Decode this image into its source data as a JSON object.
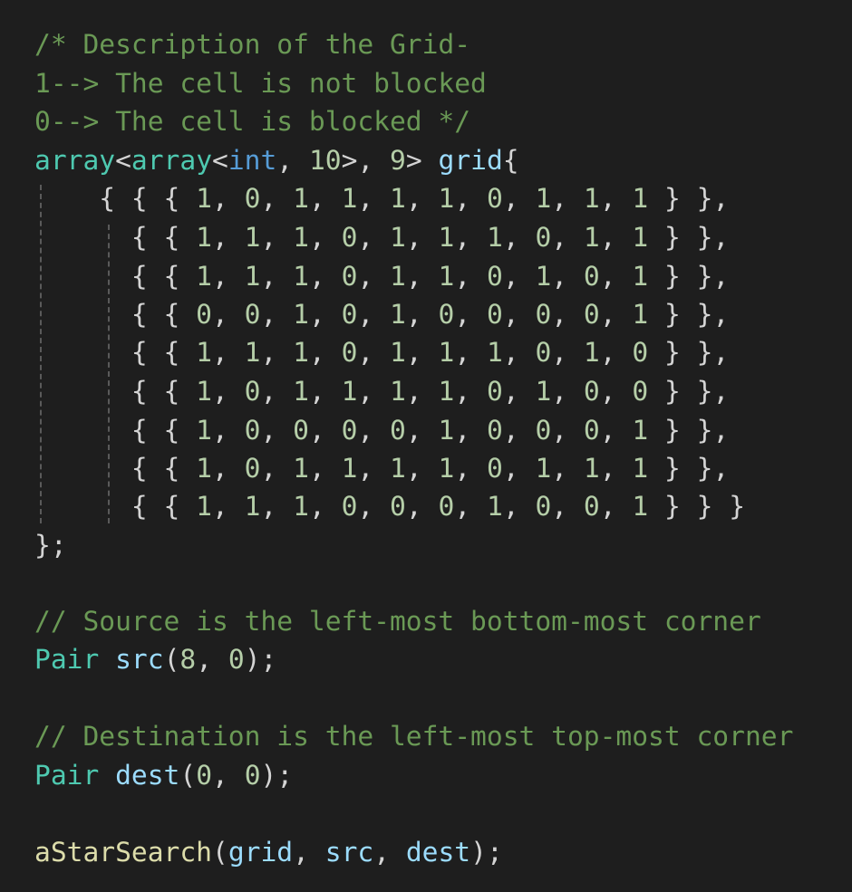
{
  "editor": {
    "colors": {
      "background": "#1e1e1e",
      "comment": "#6a9955",
      "type": "#4ec9b0",
      "keyword": "#569cd6",
      "number": "#b5cea8",
      "variable": "#9cdcfe",
      "function": "#dcdcaa",
      "text": "#d4d4d4"
    },
    "lines": [
      [
        {
          "t": "/* Description of the Grid-",
          "c": "comment"
        }
      ],
      [
        {
          "t": "1--> The cell is not blocked",
          "c": "comment"
        }
      ],
      [
        {
          "t": "0--> The cell is blocked */",
          "c": "comment"
        }
      ],
      [
        {
          "t": "array",
          "c": "type"
        },
        {
          "t": "<",
          "c": "punct"
        },
        {
          "t": "array",
          "c": "type"
        },
        {
          "t": "<",
          "c": "punct"
        },
        {
          "t": "int",
          "c": "kw"
        },
        {
          "t": ", ",
          "c": "punct"
        },
        {
          "t": "10",
          "c": "num"
        },
        {
          "t": ">, ",
          "c": "punct"
        },
        {
          "t": "9",
          "c": "num"
        },
        {
          "t": "> ",
          "c": "punct"
        },
        {
          "t": "grid",
          "c": "var"
        },
        {
          "t": "{",
          "c": "punct"
        }
      ],
      [
        {
          "t": "    { { { ",
          "c": "punct"
        },
        {
          "t": "1",
          "c": "num"
        },
        {
          "t": ", ",
          "c": "punct"
        },
        {
          "t": "0",
          "c": "num"
        },
        {
          "t": ", ",
          "c": "punct"
        },
        {
          "t": "1",
          "c": "num"
        },
        {
          "t": ", ",
          "c": "punct"
        },
        {
          "t": "1",
          "c": "num"
        },
        {
          "t": ", ",
          "c": "punct"
        },
        {
          "t": "1",
          "c": "num"
        },
        {
          "t": ", ",
          "c": "punct"
        },
        {
          "t": "1",
          "c": "num"
        },
        {
          "t": ", ",
          "c": "punct"
        },
        {
          "t": "0",
          "c": "num"
        },
        {
          "t": ", ",
          "c": "punct"
        },
        {
          "t": "1",
          "c": "num"
        },
        {
          "t": ", ",
          "c": "punct"
        },
        {
          "t": "1",
          "c": "num"
        },
        {
          "t": ", ",
          "c": "punct"
        },
        {
          "t": "1",
          "c": "num"
        },
        {
          "t": " } },",
          "c": "punct"
        }
      ],
      [
        {
          "t": "      { { ",
          "c": "punct"
        },
        {
          "t": "1",
          "c": "num"
        },
        {
          "t": ", ",
          "c": "punct"
        },
        {
          "t": "1",
          "c": "num"
        },
        {
          "t": ", ",
          "c": "punct"
        },
        {
          "t": "1",
          "c": "num"
        },
        {
          "t": ", ",
          "c": "punct"
        },
        {
          "t": "0",
          "c": "num"
        },
        {
          "t": ", ",
          "c": "punct"
        },
        {
          "t": "1",
          "c": "num"
        },
        {
          "t": ", ",
          "c": "punct"
        },
        {
          "t": "1",
          "c": "num"
        },
        {
          "t": ", ",
          "c": "punct"
        },
        {
          "t": "1",
          "c": "num"
        },
        {
          "t": ", ",
          "c": "punct"
        },
        {
          "t": "0",
          "c": "num"
        },
        {
          "t": ", ",
          "c": "punct"
        },
        {
          "t": "1",
          "c": "num"
        },
        {
          "t": ", ",
          "c": "punct"
        },
        {
          "t": "1",
          "c": "num"
        },
        {
          "t": " } },",
          "c": "punct"
        }
      ],
      [
        {
          "t": "      { { ",
          "c": "punct"
        },
        {
          "t": "1",
          "c": "num"
        },
        {
          "t": ", ",
          "c": "punct"
        },
        {
          "t": "1",
          "c": "num"
        },
        {
          "t": ", ",
          "c": "punct"
        },
        {
          "t": "1",
          "c": "num"
        },
        {
          "t": ", ",
          "c": "punct"
        },
        {
          "t": "0",
          "c": "num"
        },
        {
          "t": ", ",
          "c": "punct"
        },
        {
          "t": "1",
          "c": "num"
        },
        {
          "t": ", ",
          "c": "punct"
        },
        {
          "t": "1",
          "c": "num"
        },
        {
          "t": ", ",
          "c": "punct"
        },
        {
          "t": "0",
          "c": "num"
        },
        {
          "t": ", ",
          "c": "punct"
        },
        {
          "t": "1",
          "c": "num"
        },
        {
          "t": ", ",
          "c": "punct"
        },
        {
          "t": "0",
          "c": "num"
        },
        {
          "t": ", ",
          "c": "punct"
        },
        {
          "t": "1",
          "c": "num"
        },
        {
          "t": " } },",
          "c": "punct"
        }
      ],
      [
        {
          "t": "      { { ",
          "c": "punct"
        },
        {
          "t": "0",
          "c": "num"
        },
        {
          "t": ", ",
          "c": "punct"
        },
        {
          "t": "0",
          "c": "num"
        },
        {
          "t": ", ",
          "c": "punct"
        },
        {
          "t": "1",
          "c": "num"
        },
        {
          "t": ", ",
          "c": "punct"
        },
        {
          "t": "0",
          "c": "num"
        },
        {
          "t": ", ",
          "c": "punct"
        },
        {
          "t": "1",
          "c": "num"
        },
        {
          "t": ", ",
          "c": "punct"
        },
        {
          "t": "0",
          "c": "num"
        },
        {
          "t": ", ",
          "c": "punct"
        },
        {
          "t": "0",
          "c": "num"
        },
        {
          "t": ", ",
          "c": "punct"
        },
        {
          "t": "0",
          "c": "num"
        },
        {
          "t": ", ",
          "c": "punct"
        },
        {
          "t": "0",
          "c": "num"
        },
        {
          "t": ", ",
          "c": "punct"
        },
        {
          "t": "1",
          "c": "num"
        },
        {
          "t": " } },",
          "c": "punct"
        }
      ],
      [
        {
          "t": "      { { ",
          "c": "punct"
        },
        {
          "t": "1",
          "c": "num"
        },
        {
          "t": ", ",
          "c": "punct"
        },
        {
          "t": "1",
          "c": "num"
        },
        {
          "t": ", ",
          "c": "punct"
        },
        {
          "t": "1",
          "c": "num"
        },
        {
          "t": ", ",
          "c": "punct"
        },
        {
          "t": "0",
          "c": "num"
        },
        {
          "t": ", ",
          "c": "punct"
        },
        {
          "t": "1",
          "c": "num"
        },
        {
          "t": ", ",
          "c": "punct"
        },
        {
          "t": "1",
          "c": "num"
        },
        {
          "t": ", ",
          "c": "punct"
        },
        {
          "t": "1",
          "c": "num"
        },
        {
          "t": ", ",
          "c": "punct"
        },
        {
          "t": "0",
          "c": "num"
        },
        {
          "t": ", ",
          "c": "punct"
        },
        {
          "t": "1",
          "c": "num"
        },
        {
          "t": ", ",
          "c": "punct"
        },
        {
          "t": "0",
          "c": "num"
        },
        {
          "t": " } },",
          "c": "punct"
        }
      ],
      [
        {
          "t": "      { { ",
          "c": "punct"
        },
        {
          "t": "1",
          "c": "num"
        },
        {
          "t": ", ",
          "c": "punct"
        },
        {
          "t": "0",
          "c": "num"
        },
        {
          "t": ", ",
          "c": "punct"
        },
        {
          "t": "1",
          "c": "num"
        },
        {
          "t": ", ",
          "c": "punct"
        },
        {
          "t": "1",
          "c": "num"
        },
        {
          "t": ", ",
          "c": "punct"
        },
        {
          "t": "1",
          "c": "num"
        },
        {
          "t": ", ",
          "c": "punct"
        },
        {
          "t": "1",
          "c": "num"
        },
        {
          "t": ", ",
          "c": "punct"
        },
        {
          "t": "0",
          "c": "num"
        },
        {
          "t": ", ",
          "c": "punct"
        },
        {
          "t": "1",
          "c": "num"
        },
        {
          "t": ", ",
          "c": "punct"
        },
        {
          "t": "0",
          "c": "num"
        },
        {
          "t": ", ",
          "c": "punct"
        },
        {
          "t": "0",
          "c": "num"
        },
        {
          "t": " } },",
          "c": "punct"
        }
      ],
      [
        {
          "t": "      { { ",
          "c": "punct"
        },
        {
          "t": "1",
          "c": "num"
        },
        {
          "t": ", ",
          "c": "punct"
        },
        {
          "t": "0",
          "c": "num"
        },
        {
          "t": ", ",
          "c": "punct"
        },
        {
          "t": "0",
          "c": "num"
        },
        {
          "t": ", ",
          "c": "punct"
        },
        {
          "t": "0",
          "c": "num"
        },
        {
          "t": ", ",
          "c": "punct"
        },
        {
          "t": "0",
          "c": "num"
        },
        {
          "t": ", ",
          "c": "punct"
        },
        {
          "t": "1",
          "c": "num"
        },
        {
          "t": ", ",
          "c": "punct"
        },
        {
          "t": "0",
          "c": "num"
        },
        {
          "t": ", ",
          "c": "punct"
        },
        {
          "t": "0",
          "c": "num"
        },
        {
          "t": ", ",
          "c": "punct"
        },
        {
          "t": "0",
          "c": "num"
        },
        {
          "t": ", ",
          "c": "punct"
        },
        {
          "t": "1",
          "c": "num"
        },
        {
          "t": " } },",
          "c": "punct"
        }
      ],
      [
        {
          "t": "      { { ",
          "c": "punct"
        },
        {
          "t": "1",
          "c": "num"
        },
        {
          "t": ", ",
          "c": "punct"
        },
        {
          "t": "0",
          "c": "num"
        },
        {
          "t": ", ",
          "c": "punct"
        },
        {
          "t": "1",
          "c": "num"
        },
        {
          "t": ", ",
          "c": "punct"
        },
        {
          "t": "1",
          "c": "num"
        },
        {
          "t": ", ",
          "c": "punct"
        },
        {
          "t": "1",
          "c": "num"
        },
        {
          "t": ", ",
          "c": "punct"
        },
        {
          "t": "1",
          "c": "num"
        },
        {
          "t": ", ",
          "c": "punct"
        },
        {
          "t": "0",
          "c": "num"
        },
        {
          "t": ", ",
          "c": "punct"
        },
        {
          "t": "1",
          "c": "num"
        },
        {
          "t": ", ",
          "c": "punct"
        },
        {
          "t": "1",
          "c": "num"
        },
        {
          "t": ", ",
          "c": "punct"
        },
        {
          "t": "1",
          "c": "num"
        },
        {
          "t": " } },",
          "c": "punct"
        }
      ],
      [
        {
          "t": "      { { ",
          "c": "punct"
        },
        {
          "t": "1",
          "c": "num"
        },
        {
          "t": ", ",
          "c": "punct"
        },
        {
          "t": "1",
          "c": "num"
        },
        {
          "t": ", ",
          "c": "punct"
        },
        {
          "t": "1",
          "c": "num"
        },
        {
          "t": ", ",
          "c": "punct"
        },
        {
          "t": "0",
          "c": "num"
        },
        {
          "t": ", ",
          "c": "punct"
        },
        {
          "t": "0",
          "c": "num"
        },
        {
          "t": ", ",
          "c": "punct"
        },
        {
          "t": "0",
          "c": "num"
        },
        {
          "t": ", ",
          "c": "punct"
        },
        {
          "t": "1",
          "c": "num"
        },
        {
          "t": ", ",
          "c": "punct"
        },
        {
          "t": "0",
          "c": "num"
        },
        {
          "t": ", ",
          "c": "punct"
        },
        {
          "t": "0",
          "c": "num"
        },
        {
          "t": ", ",
          "c": "punct"
        },
        {
          "t": "1",
          "c": "num"
        },
        {
          "t": " } } }",
          "c": "punct"
        }
      ],
      [
        {
          "t": "};",
          "c": "punct"
        }
      ],
      [],
      [
        {
          "t": "// Source is the left-most bottom-most corner",
          "c": "comment"
        }
      ],
      [
        {
          "t": "Pair",
          "c": "type"
        },
        {
          "t": " ",
          "c": "punct"
        },
        {
          "t": "src",
          "c": "var"
        },
        {
          "t": "(",
          "c": "punct"
        },
        {
          "t": "8",
          "c": "num"
        },
        {
          "t": ", ",
          "c": "punct"
        },
        {
          "t": "0",
          "c": "num"
        },
        {
          "t": ");",
          "c": "punct"
        }
      ],
      [],
      [
        {
          "t": "// Destination is the left-most top-most corner",
          "c": "comment"
        }
      ],
      [
        {
          "t": "Pair",
          "c": "type"
        },
        {
          "t": " ",
          "c": "punct"
        },
        {
          "t": "dest",
          "c": "var"
        },
        {
          "t": "(",
          "c": "punct"
        },
        {
          "t": "0",
          "c": "num"
        },
        {
          "t": ", ",
          "c": "punct"
        },
        {
          "t": "0",
          "c": "num"
        },
        {
          "t": ");",
          "c": "punct"
        }
      ],
      [],
      [
        {
          "t": "aStarSearch",
          "c": "fn"
        },
        {
          "t": "(",
          "c": "punct"
        },
        {
          "t": "grid",
          "c": "var"
        },
        {
          "t": ", ",
          "c": "punct"
        },
        {
          "t": "src",
          "c": "var"
        },
        {
          "t": ", ",
          "c": "punct"
        },
        {
          "t": "dest",
          "c": "var"
        },
        {
          "t": ");",
          "c": "punct"
        }
      ]
    ]
  }
}
